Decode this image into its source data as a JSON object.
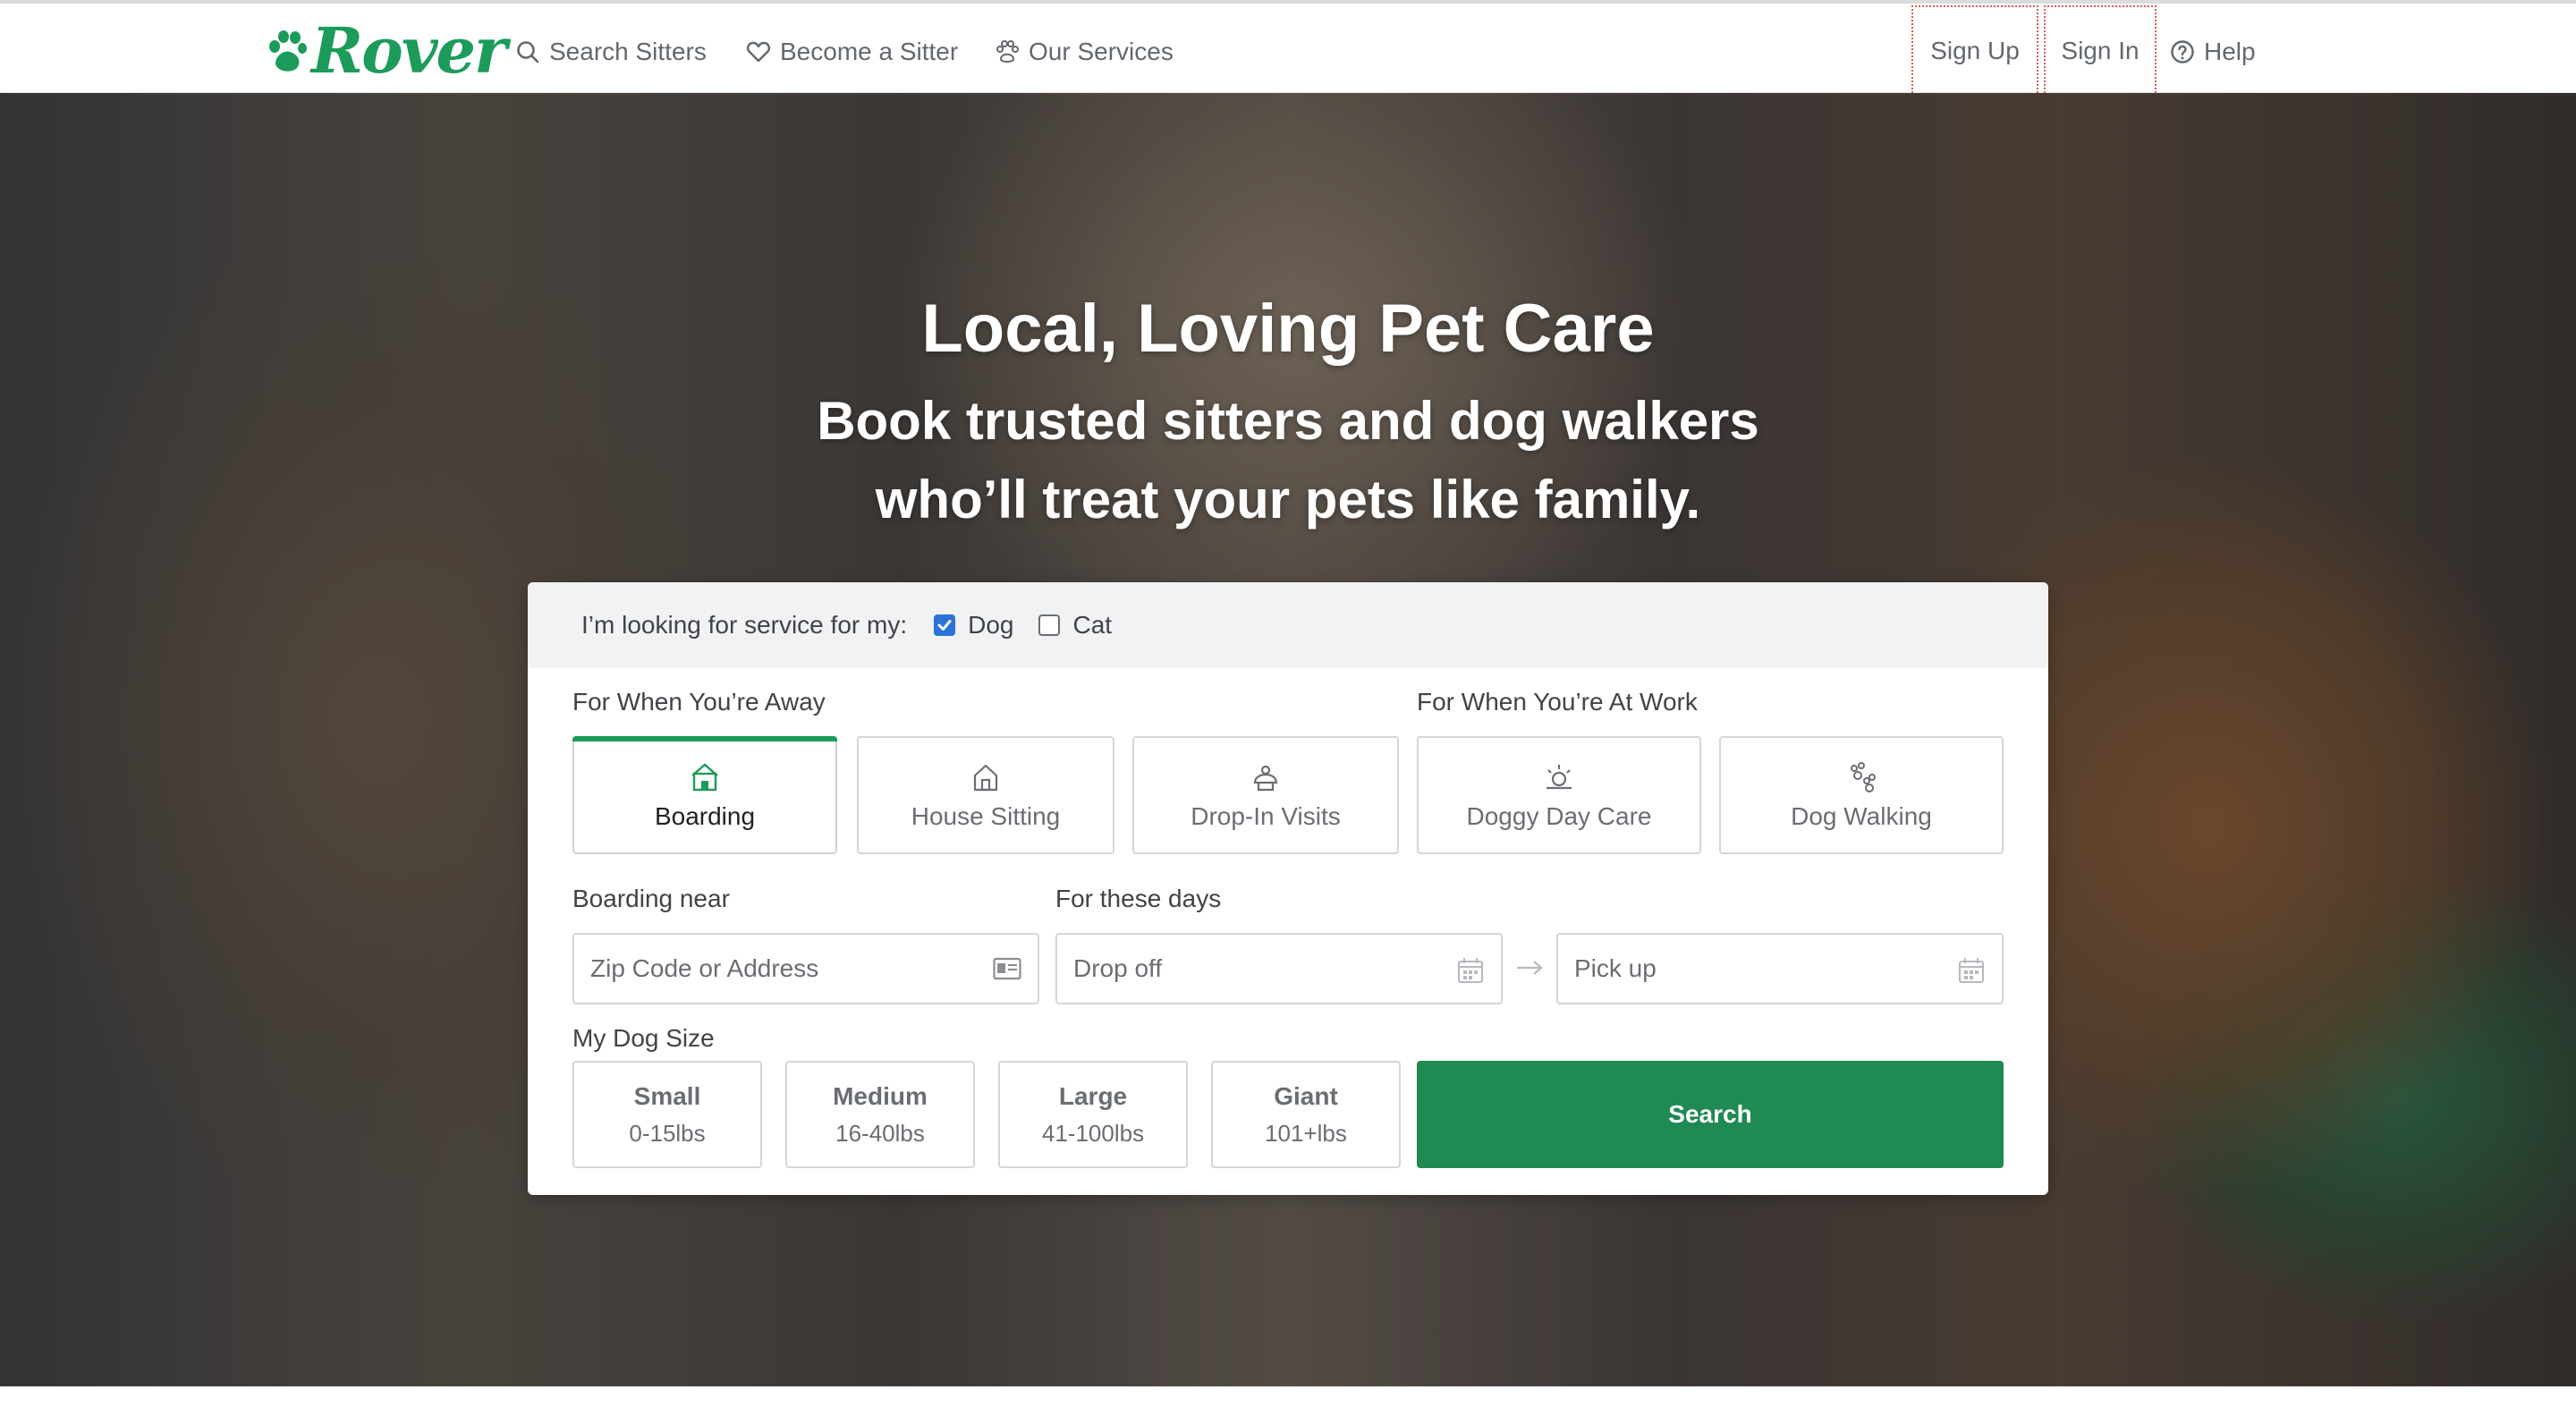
{
  "brand": {
    "name": "Rover",
    "color": "#1c9b5a"
  },
  "nav": {
    "search_sitters": "Search Sitters",
    "become_sitter": "Become a Sitter",
    "our_services": "Our Services",
    "sign_up": "Sign Up",
    "sign_in": "Sign In",
    "help": "Help"
  },
  "hero": {
    "title": "Local, Loving Pet Care",
    "subtitle_line1": "Book trusted sitters and dog walkers",
    "subtitle_line2": "who’ll treat your pets like family."
  },
  "search": {
    "pet_prompt": "I’m looking for service for my:",
    "pets": [
      {
        "label": "Dog",
        "checked": true
      },
      {
        "label": "Cat",
        "checked": false
      }
    ],
    "away_label": "For When You’re Away",
    "work_label": "For When You’re At Work",
    "services": [
      {
        "label": "Boarding",
        "icon": "boarding-icon",
        "active": true
      },
      {
        "label": "House Sitting",
        "icon": "house-sitting-icon",
        "active": false
      },
      {
        "label": "Drop-In Visits",
        "icon": "drop-in-icon",
        "active": false
      },
      {
        "label": "Doggy Day Care",
        "icon": "day-care-icon",
        "active": false
      },
      {
        "label": "Dog Walking",
        "icon": "dog-walking-icon",
        "active": false
      }
    ],
    "near_label": "Boarding near",
    "zip_placeholder": "Zip Code or Address",
    "days_label": "For these days",
    "drop_off_placeholder": "Drop off",
    "pick_up_placeholder": "Pick up",
    "size_label": "My Dog Size",
    "sizes": [
      {
        "name": "Small",
        "range": "0-15lbs"
      },
      {
        "name": "Medium",
        "range": "16-40lbs"
      },
      {
        "name": "Large",
        "range": "41-100lbs"
      },
      {
        "name": "Giant",
        "range": "101+lbs"
      }
    ],
    "search_button": "Search",
    "accent": "#1f8a52",
    "checkbox_color": "#2a73d8"
  }
}
